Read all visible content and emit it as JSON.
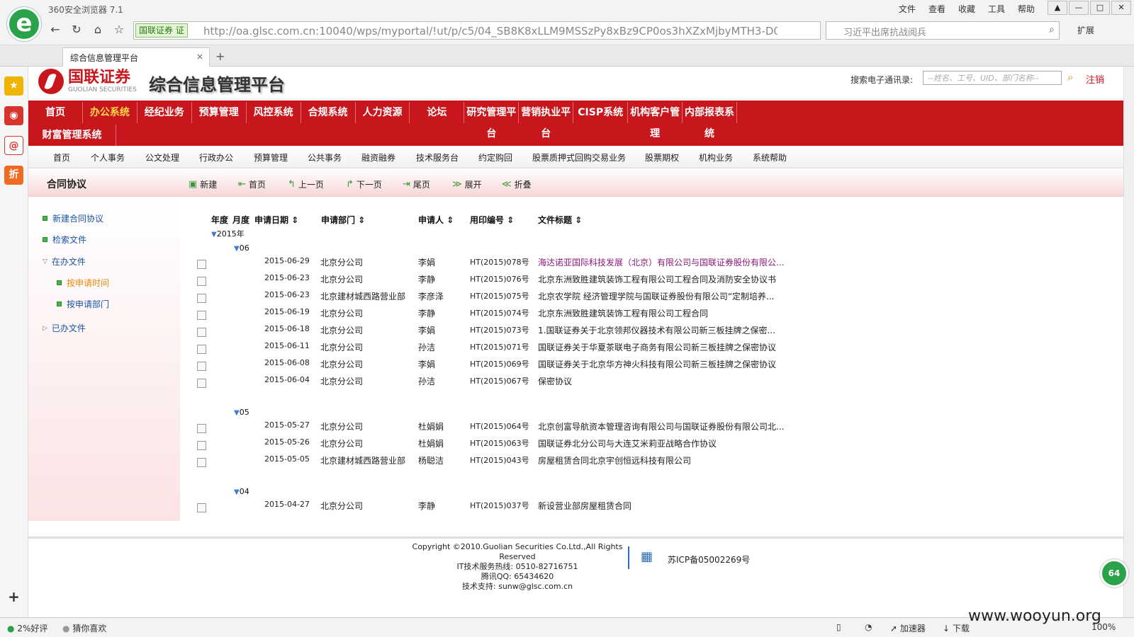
{
  "browser": {
    "title": "360安全浏览器 7.1",
    "menu": [
      "文件",
      "查看",
      "收藏",
      "工具",
      "帮助"
    ],
    "cert_label": "国联证券 证",
    "url": "http://oa.glsc.com.cn:10040/wps/myportal/!ut/p/c5/04_SB8K8xLLM9MSSzPy8xBz9CP0os3hXZxMjbyMTH3-D0BAj",
    "search_placeholder": "习近平出席抗战阅兵",
    "ext_label": "扩展",
    "tab_title": "综合信息管理平台",
    "accent": "#2aa24a"
  },
  "header": {
    "logo_cn": "国联证券",
    "logo_en": "GUOLIAN SECURITIES",
    "platform_title": "综合信息管理平台",
    "directory_label": "搜索电子通讯录:",
    "directory_placeholder": "--姓名、工号、UID、部门名称--",
    "logout": "注销",
    "brand_color": "#c8161d"
  },
  "main_nav": {
    "row1": [
      "首页",
      "办公系统",
      "经纪业务",
      "预算管理",
      "风控系统",
      "合规系统",
      "人力资源",
      "论坛",
      "研究管理平台",
      "营销执业平台",
      "CISP系统",
      "机构客户管理",
      "内部报表系统"
    ],
    "row2": [
      "财富管理系统"
    ],
    "active": "办公系统"
  },
  "sub_nav": [
    "首页",
    "个人事务",
    "公文处理",
    "行政办公",
    "预算管理",
    "公共事务",
    "融资融券",
    "技术服务台",
    "约定购回",
    "股票质押式回购交易业务",
    "股票期权",
    "机构业务",
    "系统帮助"
  ],
  "section": {
    "title": "合同协议",
    "toolbar": [
      "新建",
      "首页",
      "上一页",
      "下一页",
      "尾页",
      "展开",
      "折叠"
    ]
  },
  "tree": {
    "new": "新建合同协议",
    "search": "检索文件",
    "in_progress": "在办文件",
    "by_time": "按申请时间",
    "by_dept": "按申请部门",
    "done": "已办文件"
  },
  "table": {
    "headers": [
      "年度",
      "月度",
      "申请日期",
      "申请部门",
      "申请人",
      "用印编号",
      "文件标题"
    ],
    "year": "2015年",
    "groups": [
      {
        "month": "06",
        "rows": [
          {
            "date": "2015-06-29",
            "dept": "北京分公司",
            "person": "李娟",
            "code": "HT(2015)078号",
            "title": "海达诺亚国际科技发展（北京）有限公司与国联证券股份有限公..."
          },
          {
            "date": "2015-06-23",
            "dept": "北京分公司",
            "person": "李静",
            "code": "HT(2015)076号",
            "title": "北京东洲致胜建筑装饰工程有限公司工程合同及消防安全协议书"
          },
          {
            "date": "2015-06-23",
            "dept": "北京建材城西路营业部",
            "person": "李彦泽",
            "code": "HT(2015)075号",
            "title": "北京农学院 经济管理学院与国联证券股份有限公司“定制培养..."
          },
          {
            "date": "2015-06-19",
            "dept": "北京分公司",
            "person": "李静",
            "code": "HT(2015)074号",
            "title": "北京东洲致胜建筑装饰工程有限公司工程合同"
          },
          {
            "date": "2015-06-18",
            "dept": "北京分公司",
            "person": "李娟",
            "code": "HT(2015)073号",
            "title": "1.国联证券关于北京领邦仪器技术有限公司新三板挂牌之保密..."
          },
          {
            "date": "2015-06-11",
            "dept": "北京分公司",
            "person": "孙洁",
            "code": "HT(2015)071号",
            "title": "国联证券关于华夏茶联电子商务有限公司新三板挂牌之保密协议"
          },
          {
            "date": "2015-06-08",
            "dept": "北京分公司",
            "person": "李娟",
            "code": "HT(2015)069号",
            "title": "国联证券关于北京华方神火科技有限公司新三板挂牌之保密协议"
          },
          {
            "date": "2015-06-04",
            "dept": "北京分公司",
            "person": "孙洁",
            "code": "HT(2015)067号",
            "title": "保密协议"
          }
        ]
      },
      {
        "month": "05",
        "rows": [
          {
            "date": "2015-05-27",
            "dept": "北京分公司",
            "person": "杜娟娟",
            "code": "HT(2015)064号",
            "title": "北京创富导航资本管理咨询有限公司与国联证券股份有限公司北..."
          },
          {
            "date": "2015-05-26",
            "dept": "北京分公司",
            "person": "杜娟娟",
            "code": "HT(2015)063号",
            "title": "国联证券北分公司与大连艾米莉亚战略合作协议"
          },
          {
            "date": "2015-05-05",
            "dept": "北京建材城西路营业部",
            "person": "杨聪洁",
            "code": "HT(2015)043号",
            "title": "房屋租赁合同北京宇创恒远科技有限公司"
          }
        ]
      },
      {
        "month": "04",
        "rows": [
          {
            "date": "2015-04-27",
            "dept": "北京分公司",
            "person": "李静",
            "code": "HT(2015)037号",
            "title": "新设营业部房屋租赁合同"
          }
        ]
      }
    ]
  },
  "footer": {
    "copyright": "Copyright ©2010.Guolian Securities Co.Ltd.,All Rights Reserved",
    "hotline": "IT技术服务热线: 0510-82716751",
    "qq": "腾讯QQ: 65434620",
    "support": "技术支持: sunw@glsc.com.cn",
    "icp": "苏ICP备05002269号"
  },
  "status_bar": {
    "rating": "2%好评",
    "guess": "猜你喜欢",
    "accelerator": "加速器",
    "download": "下载",
    "zoom": "100%",
    "badge": "64"
  },
  "watermark": "www.wooyun.org"
}
